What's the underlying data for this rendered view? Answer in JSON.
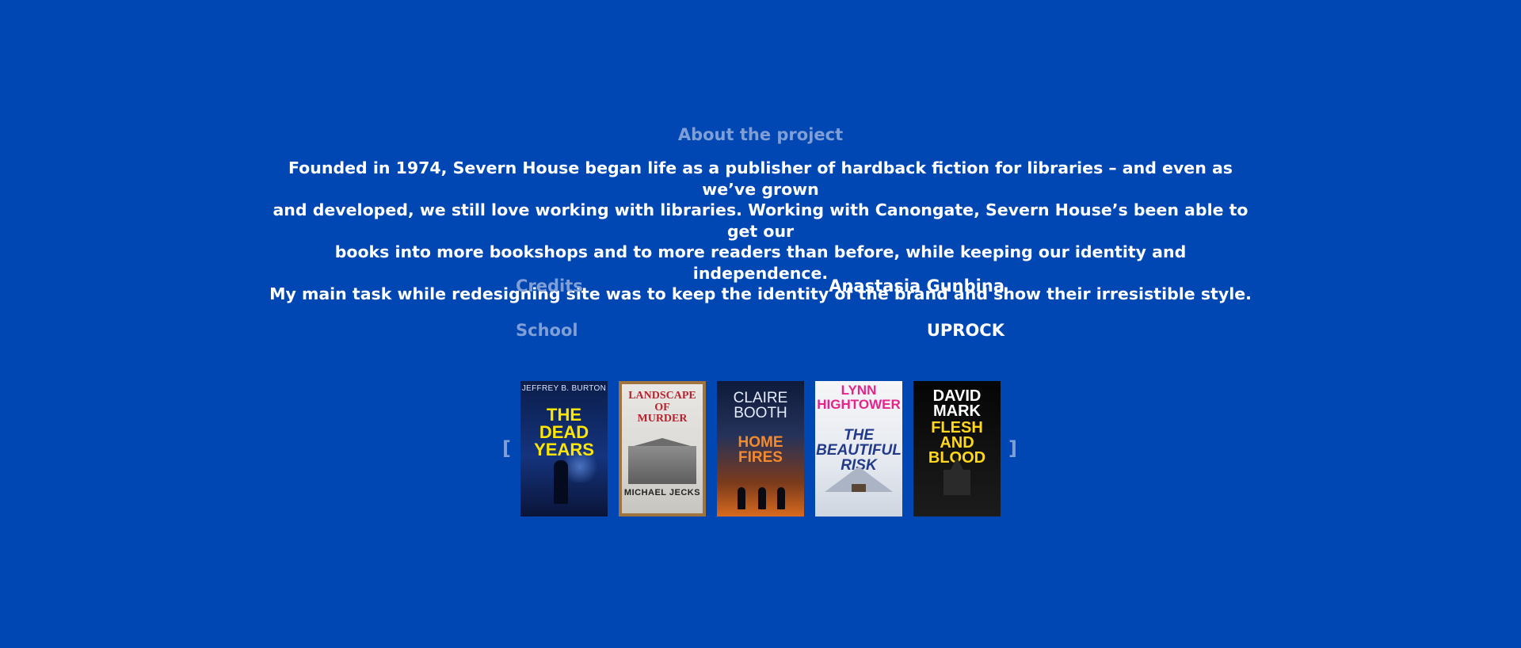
{
  "about": {
    "label": "About the project",
    "paragraph": [
      "Founded in 1974, Severn House began life as a publisher of hardback fiction for libraries – and even as we’ve grown",
      "and developed, we still love working with libraries. Working with Canongate, Severn House’s been able to get our",
      "books into more bookshops and to more readers than before, while keeping our identity and independence.",
      "My main task while redesigning site was to keep the identity of the brand and show their irresistible style."
    ]
  },
  "credits": {
    "label": "Credits",
    "value": "Anastasia Gunbina"
  },
  "school": {
    "label": "School",
    "value": "UPROCK"
  },
  "carousel": {
    "prev_glyph": "[",
    "next_glyph": "]",
    "books": [
      {
        "author": "JEFFREY B. BURTON",
        "title_line1": "THE DEAD",
        "title_line2": "YEARS"
      },
      {
        "title_line1": "LANDSCAPE",
        "title_line2": "OF",
        "title_line3": "MURDER",
        "author": "MICHAEL JECKS"
      },
      {
        "author_line1": "CLAIRE",
        "author_line2": "BOOTH",
        "title_line1": "HOME",
        "title_line2": "FIRES"
      },
      {
        "author_line1": "LYNN",
        "author_line2": "HIGHTOWER",
        "title_line1": "THE",
        "title_line2": "BEAUTIFUL",
        "title_line3": "RISK"
      },
      {
        "author_line1": "DAVID",
        "author_line2": "MARK",
        "title_line1": "FLESH",
        "title_line2": "AND",
        "title_line3": "BLOOD"
      }
    ]
  }
}
